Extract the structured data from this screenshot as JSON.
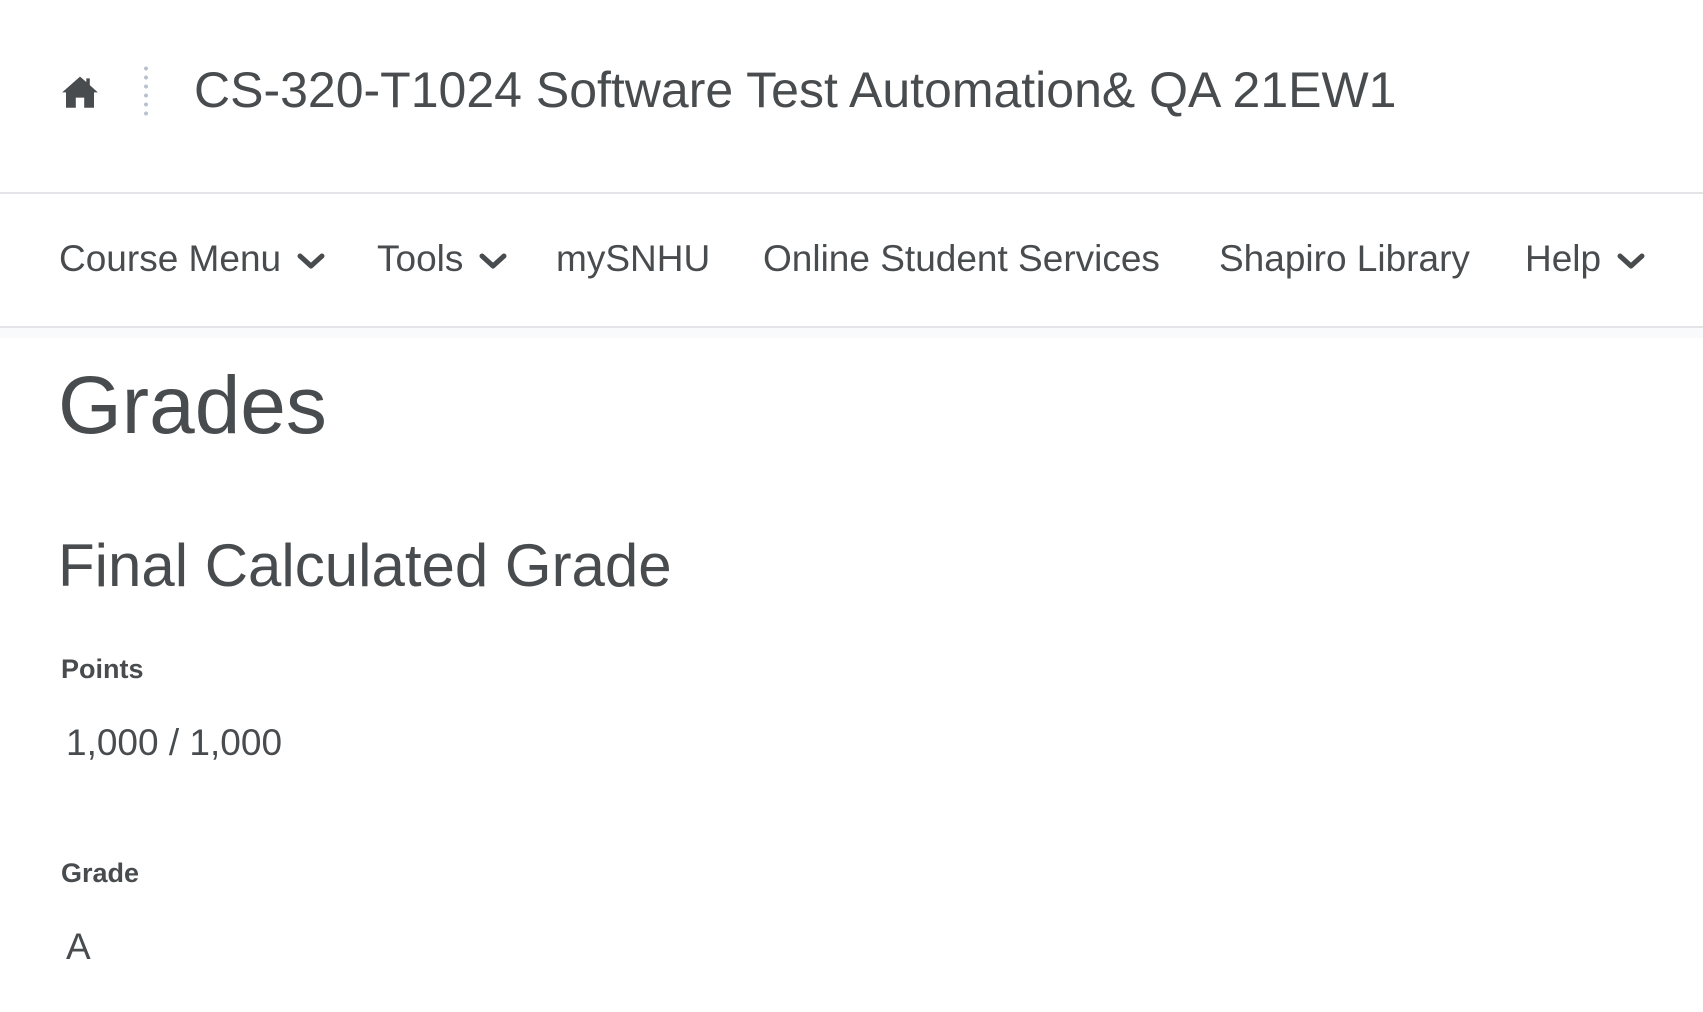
{
  "header": {
    "home_icon": "home-icon",
    "course_title": "CS-320-T1024 Software Test Automation& QA 21EW1"
  },
  "nav": {
    "items": [
      {
        "label": "Course Menu",
        "has_dropdown": true
      },
      {
        "label": "Tools",
        "has_dropdown": true
      },
      {
        "label": "mySNHU",
        "has_dropdown": false
      },
      {
        "label": "Online Student Services",
        "has_dropdown": false
      },
      {
        "label": "Shapiro Library",
        "has_dropdown": false
      },
      {
        "label": "Help",
        "has_dropdown": true
      }
    ]
  },
  "main": {
    "page_title": "Grades",
    "section_title": "Final Calculated Grade",
    "points_label": "Points",
    "points_value": "1,000 / 1,000",
    "grade_label": "Grade",
    "grade_value": "A"
  },
  "colors": {
    "text": "#494c4e",
    "border": "#e3e5e8",
    "background": "#ffffff"
  }
}
